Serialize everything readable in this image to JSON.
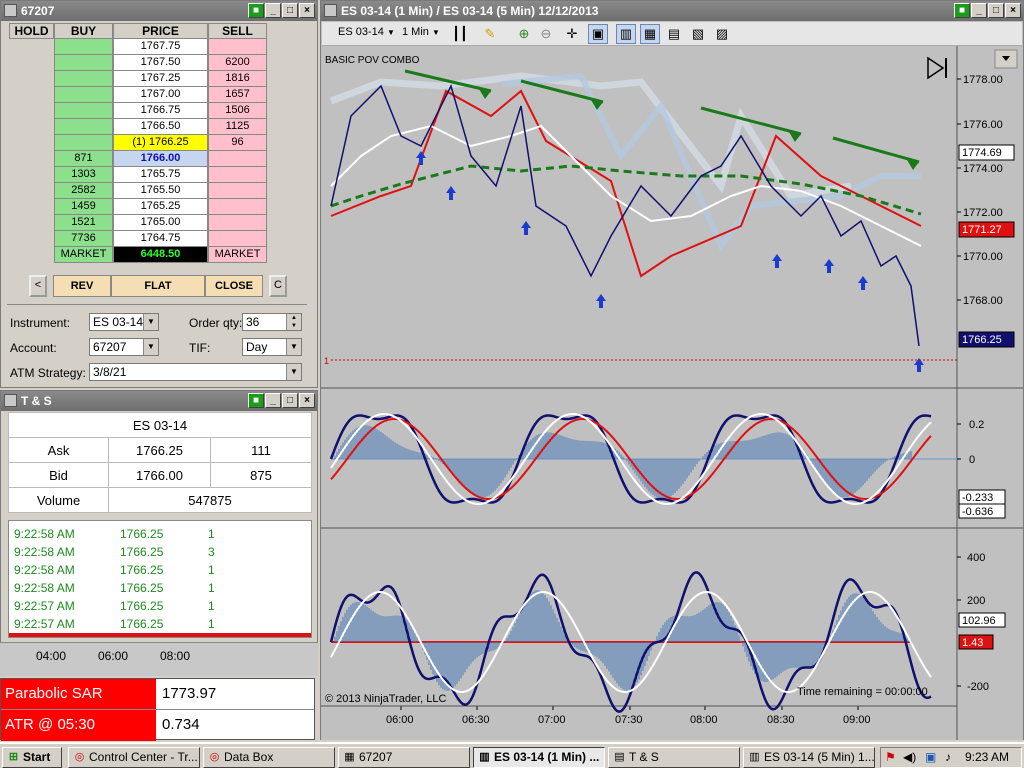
{
  "dom_window": {
    "title": "67207",
    "headers": {
      "hold": "HOLD",
      "buy": "BUY",
      "price": "PRICE",
      "sell": "SELL"
    },
    "ladder": [
      {
        "buy": "",
        "price": "1767.75",
        "sell": ""
      },
      {
        "buy": "",
        "price": "1767.50",
        "sell": "6200"
      },
      {
        "buy": "",
        "price": "1767.25",
        "sell": "1816"
      },
      {
        "buy": "",
        "price": "1767.00",
        "sell": "1657"
      },
      {
        "buy": "",
        "price": "1766.75",
        "sell": "1506"
      },
      {
        "buy": "",
        "price": "1766.50",
        "sell": "1125"
      },
      {
        "buy": "",
        "price": "(1) 1766.25",
        "sell": "96"
      },
      {
        "buy": "871",
        "price": "1766.00",
        "sell": ""
      },
      {
        "buy": "1303",
        "price": "1765.75",
        "sell": ""
      },
      {
        "buy": "2582",
        "price": "1765.50",
        "sell": ""
      },
      {
        "buy": "1459",
        "price": "1765.25",
        "sell": ""
      },
      {
        "buy": "1521",
        "price": "1765.00",
        "sell": ""
      },
      {
        "buy": "7736",
        "price": "1764.75",
        "sell": ""
      }
    ],
    "market_row": {
      "buy": "MARKET",
      "price": "6448.50",
      "sell": "MARKET"
    },
    "buttons": {
      "left": "<",
      "rev": "REV",
      "flat": "FLAT",
      "close": "CLOSE",
      "right": "C"
    },
    "instrument_label": "Instrument:",
    "instrument_value": "ES 03-14",
    "order_qty_label": "Order qty:",
    "order_qty_value": "36",
    "account_label": "Account:",
    "account_value": "67207",
    "tif_label": "TIF:",
    "tif_value": "Day",
    "atm_label": "ATM Strategy:",
    "atm_value": "3/8/21"
  },
  "ts_window": {
    "title": "T & S",
    "instrument": "ES 03-14",
    "ask_label": "Ask",
    "ask_price": "1766.25",
    "ask_size": "111",
    "bid_label": "Bid",
    "bid_price": "1766.00",
    "bid_size": "875",
    "volume_label": "Volume",
    "volume_value": "547875",
    "trades": [
      {
        "time": "9:22:58 AM",
        "price": "1766.25",
        "size": "1"
      },
      {
        "time": "9:22:58 AM",
        "price": "1766.25",
        "size": "3"
      },
      {
        "time": "9:22:58 AM",
        "price": "1766.25",
        "size": "1"
      },
      {
        "time": "9:22:58 AM",
        "price": "1766.25",
        "size": "1"
      },
      {
        "time": "9:22:57 AM",
        "price": "1766.25",
        "size": "1"
      },
      {
        "time": "9:22:57 AM",
        "price": "1766.25",
        "size": "1"
      }
    ],
    "axis_times": [
      "04:00",
      "06:00",
      "08:00"
    ]
  },
  "data_box": {
    "rows": [
      {
        "label": "Parabolic SAR",
        "value": "1773.97"
      },
      {
        "label": "ATR @ 05:30",
        "value": "0.734"
      }
    ]
  },
  "chart_window": {
    "title": "ES 03-14 (1 Min) / ES 03-14 (5 Min)  12/12/2013",
    "toolbar_instrument": "ES 03-14",
    "toolbar_interval": "1 Min",
    "strategy_label": "BASIC POV COMBO",
    "price_axis": [
      "1778.00",
      "1776.00",
      "1774.00",
      "1772.00",
      "1770.00",
      "1768.00"
    ],
    "price_markers": [
      {
        "value": "1774.69",
        "color": "#ffffff",
        "text": "#000000"
      },
      {
        "value": "1771.27",
        "color": "#e01010",
        "text": "#ffffff"
      },
      {
        "value": "1766.25",
        "color": "#10106e",
        "text": "#ffffff"
      }
    ],
    "osc1_axis": [
      "0.2",
      "0"
    ],
    "osc1_markers": [
      "-0.233",
      "-0.636"
    ],
    "osc2_axis": [
      "400",
      "200",
      "-200"
    ],
    "osc2_markers": [
      "102.96",
      "1.43"
    ],
    "time_axis": [
      "06:00",
      "06:30",
      "07:00",
      "07:30",
      "08:00",
      "08:30",
      "09:00"
    ],
    "copyright": "© 2013 NinjaTrader, LLC",
    "time_remaining": "Time remaining = 00:00:00",
    "tag_one": "1"
  },
  "taskbar": {
    "start": "Start",
    "items": [
      "Control Center - Tr...",
      "Data Box",
      "67207",
      "ES 03-14 (1 Min) ...",
      "T & S",
      "ES 03-14 (5 Min)  1..."
    ],
    "clock": "9:23 AM"
  },
  "colors": {
    "buy_green": "#8ce08c",
    "sell_pink": "#ffc0cb",
    "chart_bg": "#c0c0c0",
    "price_line": "#10106e"
  }
}
